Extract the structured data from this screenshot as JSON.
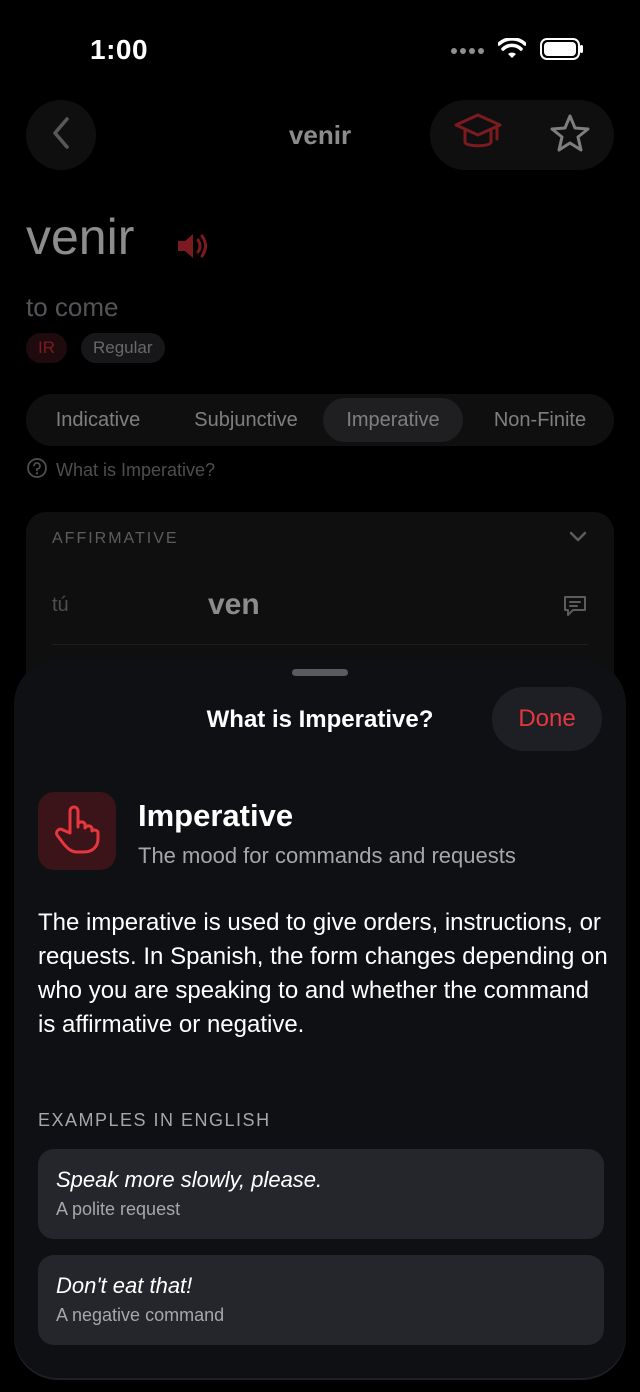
{
  "status_bar": {
    "time": "1:00"
  },
  "nav": {
    "title": "venir"
  },
  "verb": {
    "infinitive": "venir",
    "meaning": "to come",
    "tags": [
      "IR",
      "Regular"
    ]
  },
  "tabs": [
    {
      "label": "Indicative",
      "active": false
    },
    {
      "label": "Subjunctive",
      "active": false
    },
    {
      "label": "Imperative",
      "active": true
    },
    {
      "label": "Non-Finite",
      "active": false
    }
  ],
  "help_link": "What is Imperative?",
  "conjugation_card": {
    "header": "AFFIRMATIVE",
    "rows": [
      {
        "pronoun": "tú",
        "form": "ven"
      }
    ]
  },
  "sheet": {
    "title": "What is Imperative?",
    "done_label": "Done",
    "mood_name": "Imperative",
    "mood_subtitle": "The mood for commands and requests",
    "explanation": "The imperative is used to give orders, instructions, or requests. In Spanish, the form changes depending on who you are speaking to and whether the command is affirmative or negative.",
    "examples_header": "EXAMPLES IN ENGLISH",
    "examples": [
      {
        "sentence": "Speak more slowly, please.",
        "note": "A polite request"
      },
      {
        "sentence": "Don't eat that!",
        "note": "A negative command"
      }
    ]
  },
  "colors": {
    "accent": "#e8363f",
    "sheet_bg": "#0f1014",
    "card_bg": "#25262b"
  },
  "icons": [
    "back-chevron-icon",
    "graduation-cap-icon",
    "star-icon",
    "speaker-icon",
    "question-circle-icon",
    "chevron-down-icon",
    "speech-bubble-icon",
    "pointing-hand-icon"
  ]
}
